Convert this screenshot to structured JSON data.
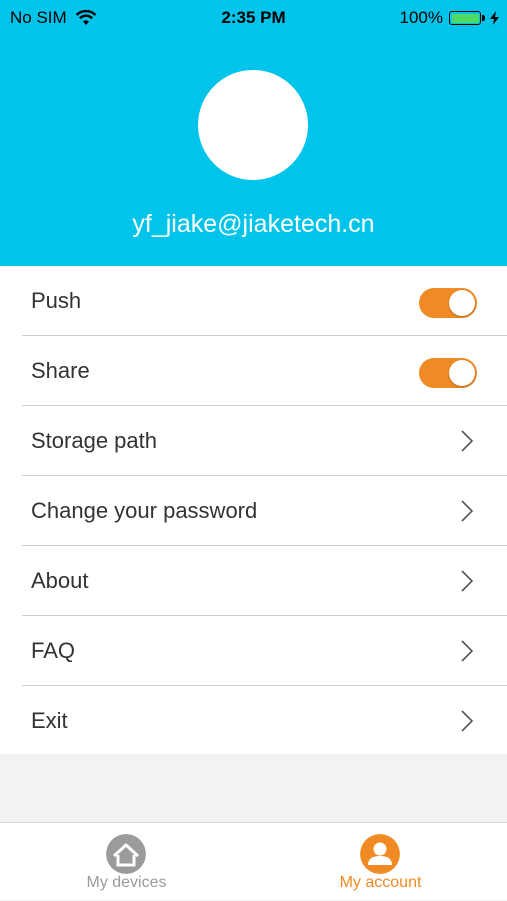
{
  "status_bar": {
    "carrier": "No SIM",
    "time": "2:35 PM",
    "battery": "100%"
  },
  "profile": {
    "email": "yf_jiake@jiaketech.cn"
  },
  "menu": {
    "items": [
      {
        "label": "Push",
        "control": "toggle",
        "on": true
      },
      {
        "label": "Share",
        "control": "toggle",
        "on": true
      },
      {
        "label": "Storage path",
        "control": "chevron"
      },
      {
        "label": "Change your password",
        "control": "chevron"
      },
      {
        "label": "About",
        "control": "chevron"
      },
      {
        "label": "FAQ",
        "control": "chevron"
      },
      {
        "label": "Exit",
        "control": "chevron"
      }
    ]
  },
  "tabbar": {
    "tabs": [
      {
        "label": "My devices",
        "icon": "home-icon",
        "active": false
      },
      {
        "label": "My account",
        "icon": "user-icon",
        "active": true
      }
    ]
  },
  "colors": {
    "header": "#00c4ea",
    "accent": "#f08a24",
    "inactive": "#9b9b9b"
  }
}
